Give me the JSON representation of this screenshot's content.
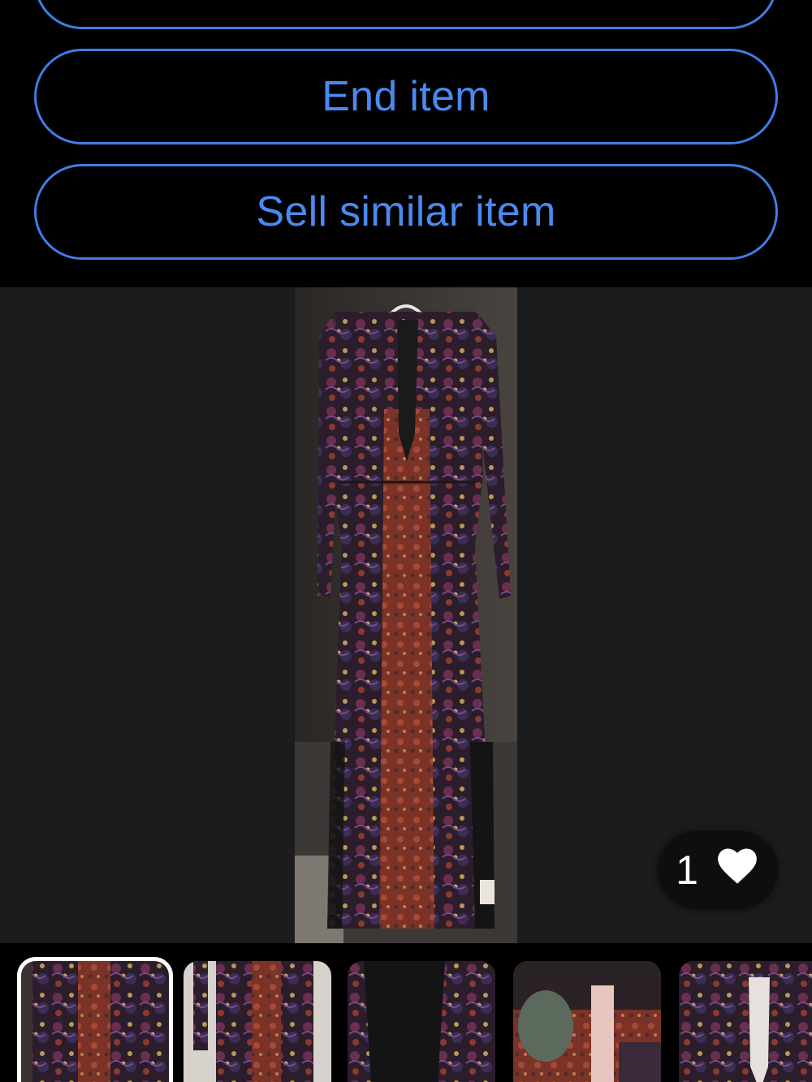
{
  "actions": {
    "top_partial_label": "",
    "end_item_label": "End item",
    "sell_similar_label": "Sell similar item"
  },
  "gallery": {
    "like_count": "1",
    "like_icon": "heart-icon",
    "thumbnails": [
      {
        "label": "photo-1",
        "selected": true
      },
      {
        "label": "photo-2",
        "selected": false
      },
      {
        "label": "photo-3",
        "selected": false
      },
      {
        "label": "photo-4",
        "selected": false
      },
      {
        "label": "photo-5",
        "selected": false
      }
    ]
  },
  "colors": {
    "accent": "#4a8af0",
    "background": "#000000",
    "gallery_bg": "#1c1c1c"
  }
}
